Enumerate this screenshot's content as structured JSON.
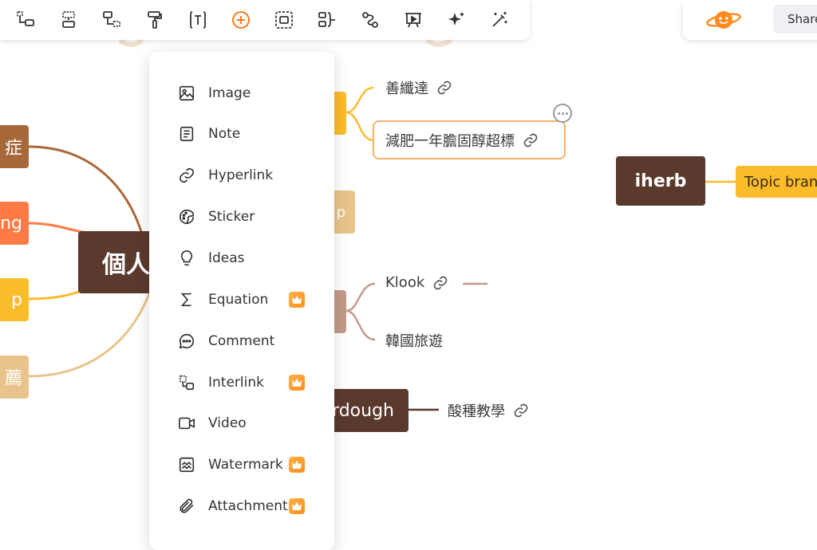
{
  "toolbar": {
    "tools": [
      {
        "icon": "subtopic-icon"
      },
      {
        "icon": "sibling-topic-icon"
      },
      {
        "icon": "parent-topic-icon"
      },
      {
        "icon": "format-painter-icon"
      },
      {
        "icon": "text-box-icon"
      },
      {
        "icon": "insert-icon",
        "active": true
      },
      {
        "icon": "boundary-icon"
      },
      {
        "icon": "summary-icon"
      },
      {
        "icon": "relationship-icon"
      },
      {
        "icon": "presentation-icon"
      },
      {
        "icon": "ai-sparkle-icon"
      },
      {
        "icon": "magic-wand-icon"
      }
    ]
  },
  "header": {
    "share_label": "Share"
  },
  "insert_menu": {
    "items": [
      {
        "label": "Image",
        "icon": "image-icon",
        "premium": false
      },
      {
        "label": "Note",
        "icon": "note-icon",
        "premium": false
      },
      {
        "label": "Hyperlink",
        "icon": "hyperlink-icon",
        "premium": false
      },
      {
        "label": "Sticker",
        "icon": "sticker-icon",
        "premium": false
      },
      {
        "label": "Ideas",
        "icon": "lightbulb-icon",
        "premium": false
      },
      {
        "label": "Equation",
        "icon": "sigma-icon",
        "premium": true
      },
      {
        "label": "Comment",
        "icon": "comment-icon",
        "premium": false
      },
      {
        "label": "Interlink",
        "icon": "interlink-icon",
        "premium": true
      },
      {
        "label": "Video",
        "icon": "video-icon",
        "premium": false
      },
      {
        "label": "Watermark",
        "icon": "watermark-icon",
        "premium": true
      },
      {
        "label": "Attachment",
        "icon": "paperclip-icon",
        "premium": true
      }
    ]
  },
  "mindmap": {
    "central": "個人",
    "left_branches": [
      "症",
      "ng",
      "p",
      "薦"
    ],
    "subtopics": {
      "shanxianda": "善纖達",
      "diet": "減肥一年膽固醇超標",
      "klook": "Klook",
      "korea": "韓國旅遊",
      "sourdough_topic": "rdough",
      "sourdough_teach": "酸種教學",
      "partial_p": "p"
    },
    "iherb": "iherb",
    "topic_branch": "Topic bran"
  },
  "colors": {
    "dark_brown": "#5b3a2e",
    "orange": "#ff7a45",
    "yellow": "#fbbc2c",
    "sand": "#e8c48c",
    "brown": "#a8693a",
    "rose": "#c49a8a",
    "accent": "#ff7a1a"
  }
}
